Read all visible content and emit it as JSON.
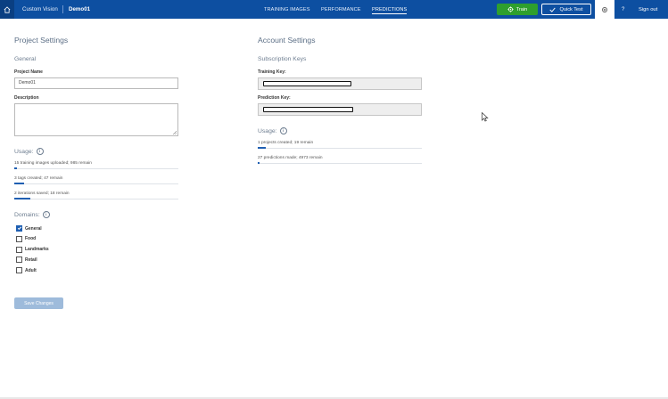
{
  "topbar": {
    "brand": "Custom Vision",
    "project": "Demo01",
    "nav": {
      "training": "TRAINING IMAGES",
      "performance": "PERFORMANCE",
      "predictions": "PREDICTIONS"
    },
    "train_label": "Train",
    "quick_test_label": "Quick Test",
    "help_label": "?",
    "signout_label": "Sign out"
  },
  "project_settings": {
    "title": "Project Settings",
    "general_heading": "General",
    "project_name_label": "Project Name",
    "project_name_value": "Demo01",
    "description_label": "Description",
    "usage_title": "Usage:",
    "usage": [
      {
        "text": "15 training images uploaded; 985 remain",
        "fraction": 0.015
      },
      {
        "text": "3 tags created; 47 remain",
        "fraction": 0.06
      },
      {
        "text": "2 iterations saved; 18 remain",
        "fraction": 0.1
      }
    ],
    "domains_title": "Domains:",
    "domains": [
      {
        "label": "General",
        "checked": true
      },
      {
        "label": "Food",
        "checked": false
      },
      {
        "label": "Landmarks",
        "checked": false
      },
      {
        "label": "Retail",
        "checked": false
      },
      {
        "label": "Adult",
        "checked": false
      }
    ],
    "save_label": "Save Changes"
  },
  "account_settings": {
    "title": "Account Settings",
    "subscription_heading": "Subscription Keys",
    "training_key_label": "Training Key:",
    "prediction_key_label": "Prediction Key:",
    "usage_title": "Usage:",
    "usage": [
      {
        "text": "1 projects created; 19 remain",
        "fraction": 0.05
      },
      {
        "text": "27 predictions made; 4973 remain",
        "fraction": 0.0054
      }
    ]
  },
  "colors": {
    "topbar": "#0d4fa1",
    "train_button": "#2e9f2e",
    "accent": "#1f5fb2",
    "save_button_disabled": "#9ebbdb"
  },
  "icons": {
    "home": "home-icon",
    "train": "gear-icon",
    "quick_test": "check-icon",
    "settings": "settings-gear-icon",
    "info": "info-icon"
  }
}
